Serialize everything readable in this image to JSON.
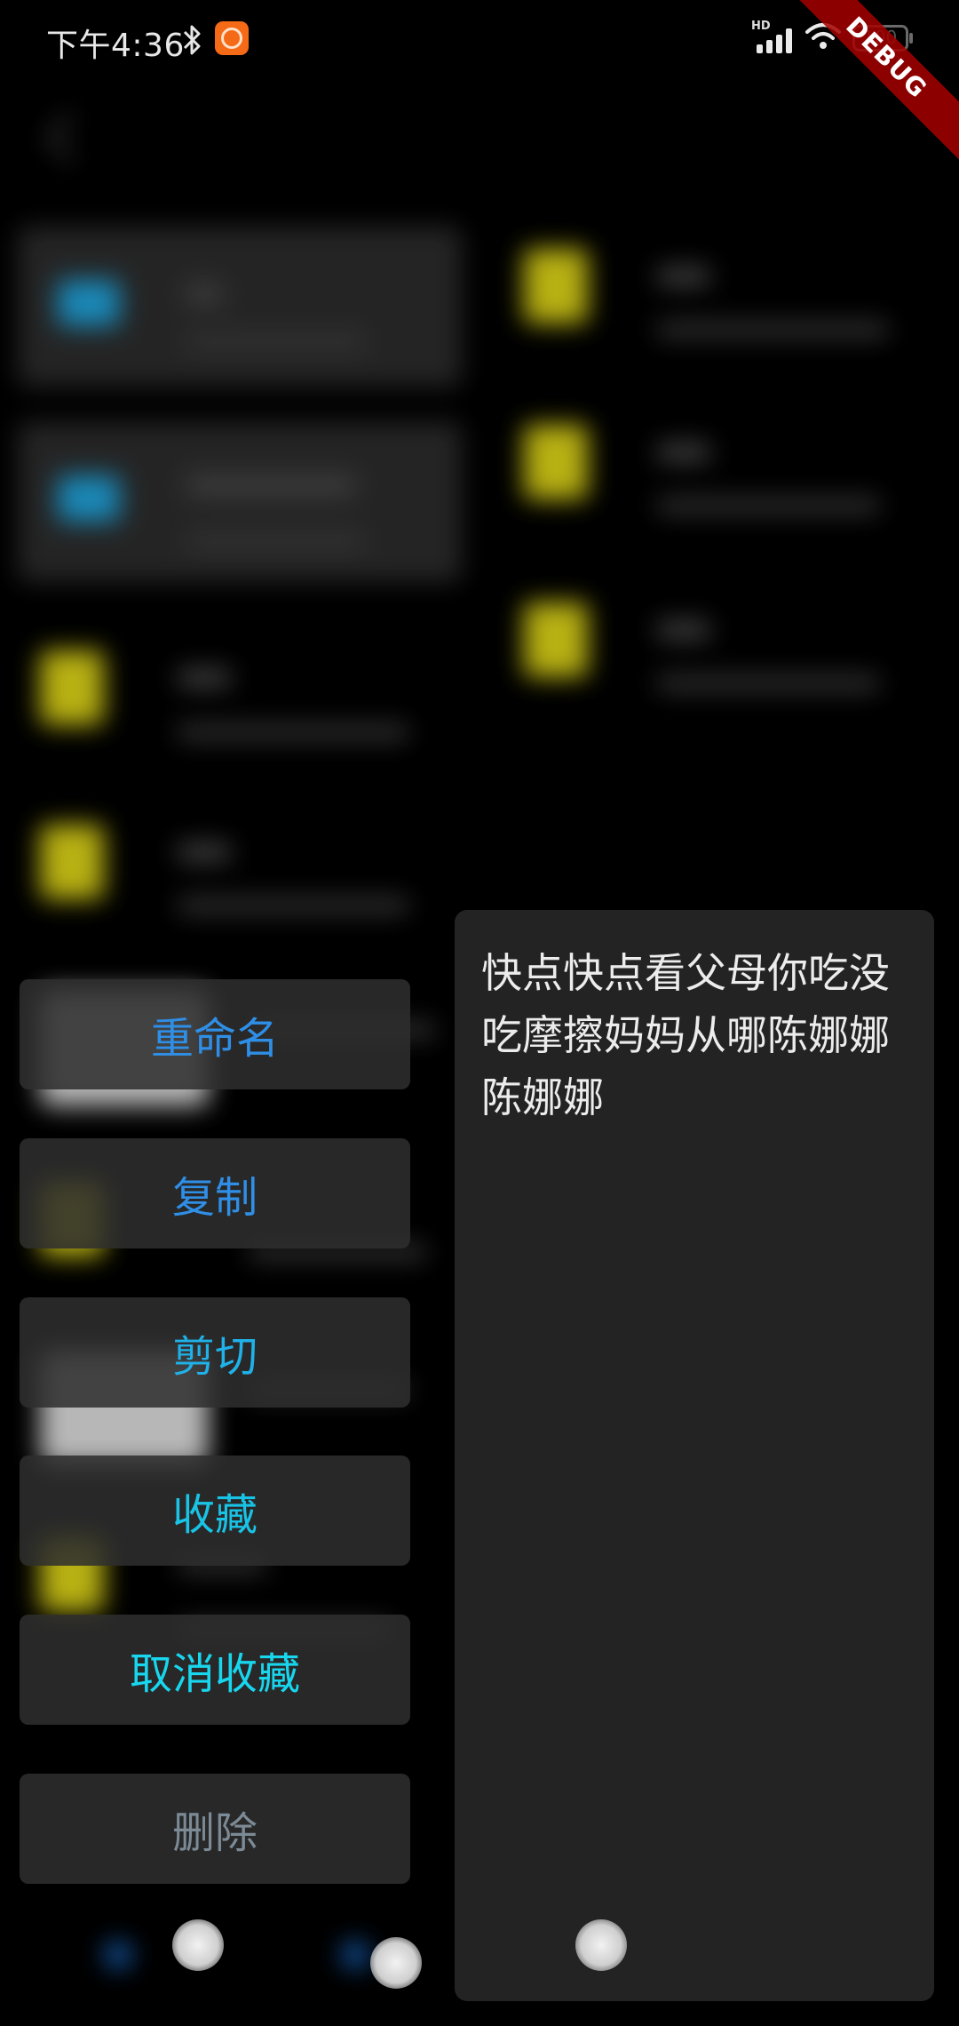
{
  "status_bar": {
    "time": "下午4:36",
    "network_label": "HD",
    "battery_level": "100",
    "debug_banner": "DEBUG",
    "icons": [
      "bluetooth-icon",
      "app-notification-icon",
      "signal-icon",
      "wifi-icon",
      "battery-icon"
    ]
  },
  "actions": [
    {
      "label": "重命名",
      "color": "#2f8fe6"
    },
    {
      "label": "复制",
      "color": "#2f8fe6"
    },
    {
      "label": "剪切",
      "color": "#1fb1e8"
    },
    {
      "label": "收藏",
      "color": "#19c3e6"
    },
    {
      "label": "取消收藏",
      "color": "#18d6ee"
    },
    {
      "label": "删除",
      "color": "#7c8a96"
    }
  ],
  "preview": {
    "text": "快点快点看父母你吃没吃摩擦妈妈从哪陈娜娜陈娜娜"
  },
  "colors": {
    "background": "#000000",
    "button_bg": "#2e2e2e",
    "panel_bg": "#232323",
    "debug_ribbon": "#a60000"
  }
}
